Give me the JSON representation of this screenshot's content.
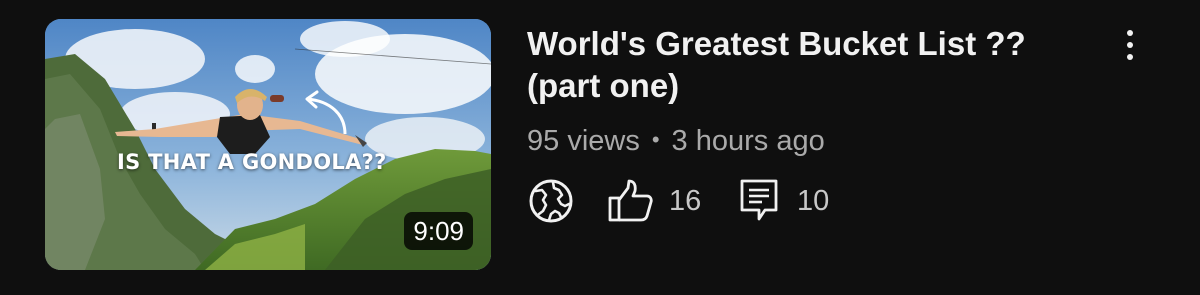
{
  "video": {
    "title": "World's Greatest Bucket List ?? (part one)",
    "thumbnail": {
      "caption": "IS THAT A GONDOLA??",
      "duration": "9:09"
    },
    "views": "95 views",
    "separator": "•",
    "age": "3 hours ago",
    "visibility_icon": "globe-icon",
    "like_icon": "thumbs-up-icon",
    "likes": "16",
    "comment_icon": "comment-icon",
    "comments": "10",
    "more_icon": "more-vertical-icon"
  },
  "colors": {
    "background": "#0f0f0f",
    "title": "#f1f1f1",
    "secondary_text": "#aaaaaa",
    "badge_bg": "#000000"
  }
}
